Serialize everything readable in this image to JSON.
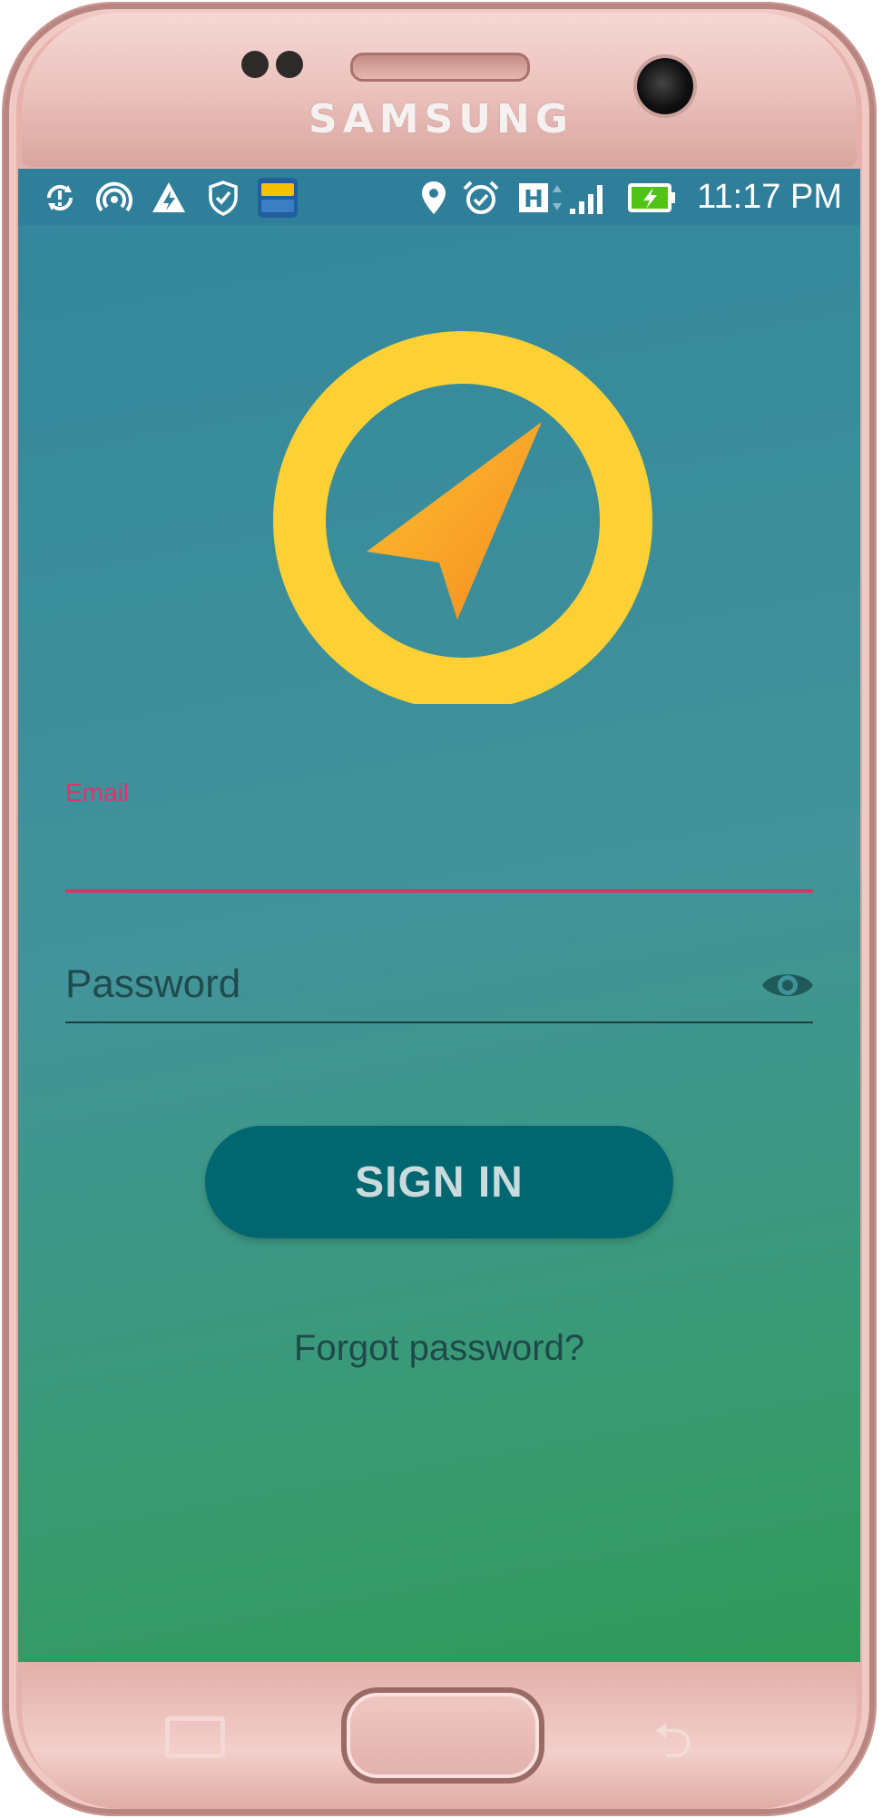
{
  "device": {
    "brand": "SAMSUNG"
  },
  "status_bar": {
    "time": "11:17 PM",
    "left_icons": [
      "sync-alert-icon",
      "hotspot-icon",
      "power-saver-icon",
      "shield-check-icon",
      "tflat-app-icon"
    ],
    "right_icons": [
      "location-pin-icon",
      "alarm-icon",
      "h-network-icon",
      "signal-bars-icon",
      "battery-charging-icon"
    ]
  },
  "login": {
    "email_label": "Email",
    "email_value": "",
    "password_placeholder": "Password",
    "signin_label": "SIGN IN",
    "forgot_label": "Forgot password?"
  },
  "colors": {
    "accent": "#d3376a",
    "button": "#00666f",
    "logo_ring": "#fdd035",
    "logo_arrow": "#f8a21f",
    "gradient_top": "#33869d",
    "gradient_bottom": "#2f9959"
  }
}
